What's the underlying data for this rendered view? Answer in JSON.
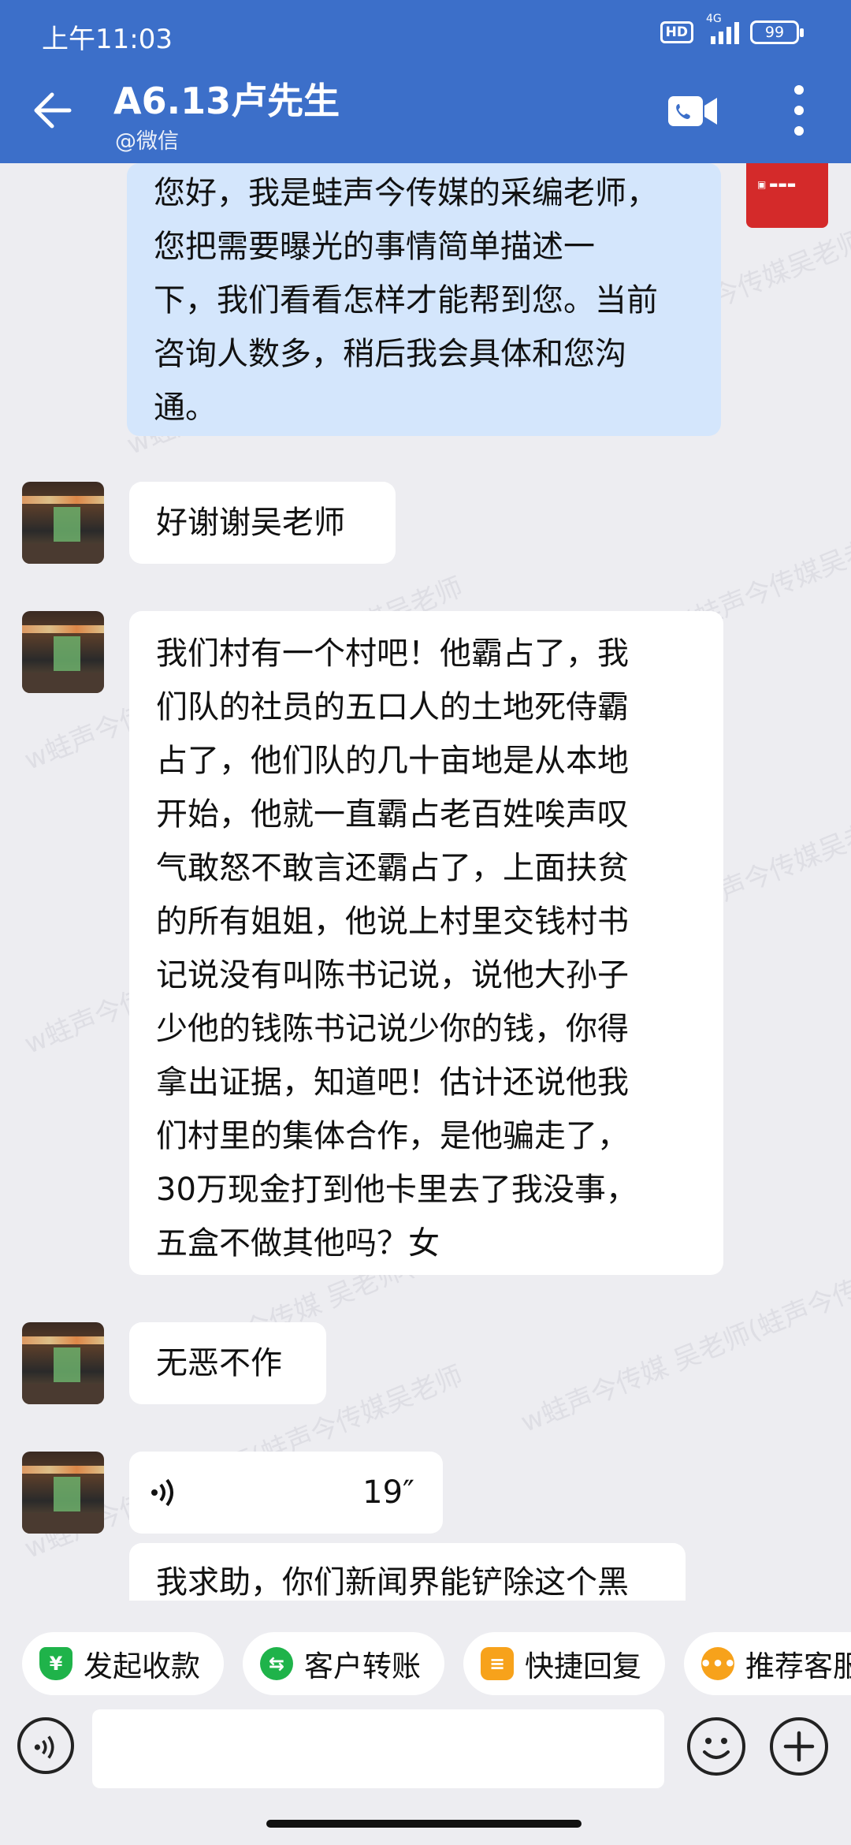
{
  "status_bar": {
    "time": "上午11:03",
    "hd": "HD",
    "network": "4G",
    "battery": "99"
  },
  "header": {
    "title": "A6.13卢先生",
    "subtitle": "@微信"
  },
  "colors": {
    "header_bg": "#3c6fc9",
    "outgoing_bubble": "#d4e6fc",
    "incoming_bubble": "#ffffff",
    "chat_bg": "#ededf1"
  },
  "messages": [
    {
      "direction": "out",
      "lines": [
        "您好，我是蛙声今传媒的采编老师，",
        "您把需要曝光的事情简单描述一",
        "下，我们看看怎样才能帮到您。当前",
        "咨询人数多，稍后我会具体和您沟",
        "通。"
      ]
    },
    {
      "direction": "in",
      "lines": [
        "好谢谢吴老师"
      ]
    },
    {
      "direction": "in",
      "lines": [
        "我们村有一个村吧！他霸占了，我",
        "们队的社员的五口人的土地死侍霸",
        "占了，他们队的几十亩地是从本地",
        "开始，他就一直霸占老百姓唉声叹",
        "气敢怒不敢言还霸占了，上面扶贫",
        "的所有姐姐，他说上村里交钱村书",
        "记说没有叫陈书记说，说他大孙子",
        "少他的钱陈书记说少你的钱，你得",
        "拿出证据，知道吧！估计还说他我",
        "们村里的集体合作，是他骗走了，",
        "30万现金打到他卡里去了我没事，",
        "五盒不做其他吗？女"
      ]
    },
    {
      "direction": "in",
      "lines": [
        "无恶不作"
      ]
    },
    {
      "direction": "in",
      "type": "voice",
      "duration": "19″"
    },
    {
      "direction": "in",
      "lines": [
        "我求助，你们新闻界能铲除这个黑"
      ]
    }
  ],
  "quick_actions": [
    {
      "label": "发起收款",
      "icon": "yuan-shield-icon",
      "color": "#1fb34a"
    },
    {
      "label": "客户转账",
      "icon": "transfer-icon",
      "color": "#1fb34a"
    },
    {
      "label": "快捷回复",
      "icon": "reply-icon",
      "color": "#f7a21b"
    },
    {
      "label": "推荐客服",
      "icon": "recommend-icon",
      "color": "#f7a21b"
    }
  ],
  "input": {
    "placeholder": ""
  }
}
